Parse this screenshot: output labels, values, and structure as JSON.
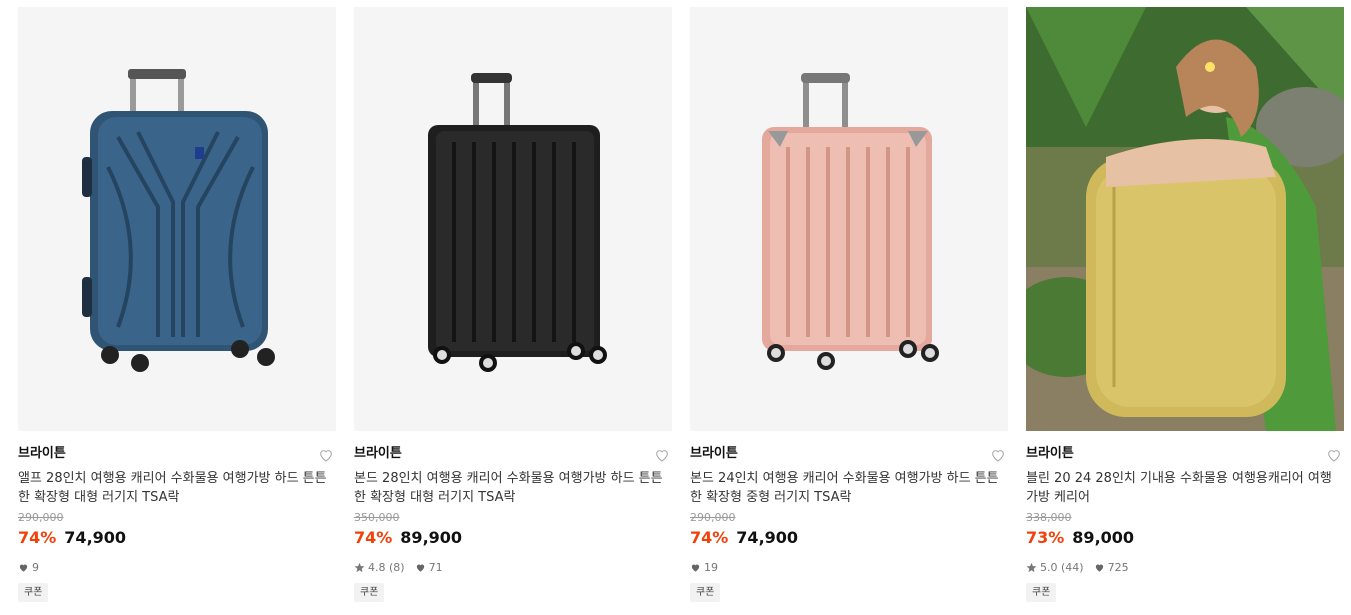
{
  "products": [
    {
      "brand": "브라이튼",
      "title": "앨프 28인치 여행용 캐리어 수화물용 여행가방 하드 튼튼한 확장형 대형 러기지 TSA락",
      "original_price": "290,000",
      "discount": "74%",
      "price": "74,900",
      "rating": "",
      "likes": "9",
      "coupon": "쿠폰",
      "image": "navy-hard-suitcase",
      "color": "#2f5474"
    },
    {
      "brand": "브라이튼",
      "title": "본드 28인치 여행용 캐리어 수화물용 여행가방 하드 튼튼한 확장형 대형 러기지 TSA락",
      "original_price": "350,000",
      "discount": "74%",
      "price": "89,900",
      "rating": "4.8 (8)",
      "likes": "71",
      "coupon": "쿠폰",
      "image": "black-hard-suitcase",
      "color": "#1e1e1e"
    },
    {
      "brand": "브라이튼",
      "title": "본드 24인치 여행용 캐리어 수화물용 여행가방 하드 튼튼한 확장형 중형 러기지 TSA락",
      "original_price": "290,000",
      "discount": "74%",
      "price": "74,900",
      "rating": "",
      "likes": "19",
      "coupon": "쿠폰",
      "image": "rose-gold-hard-suitcase",
      "color": "#e4a99c"
    },
    {
      "brand": "브라이튼",
      "title": "블린 20 24 28인치 기내용 수화물용 여행용캐리어 여행가방 케리어",
      "original_price": "338,000",
      "discount": "73%",
      "price": "89,000",
      "rating": "5.0 (44)",
      "likes": "725",
      "coupon": "쿠폰",
      "image": "woman-hugging-yellow-suitcase",
      "color": "#cfb95a"
    }
  ],
  "colors": {
    "discount": "#f1410b",
    "strike": "#9a9a9a",
    "image_bg": "#f5f5f5"
  },
  "icons": {
    "wishlist": "heart-outline-icon",
    "likes": "heart-filled-icon",
    "rating": "star-icon"
  }
}
